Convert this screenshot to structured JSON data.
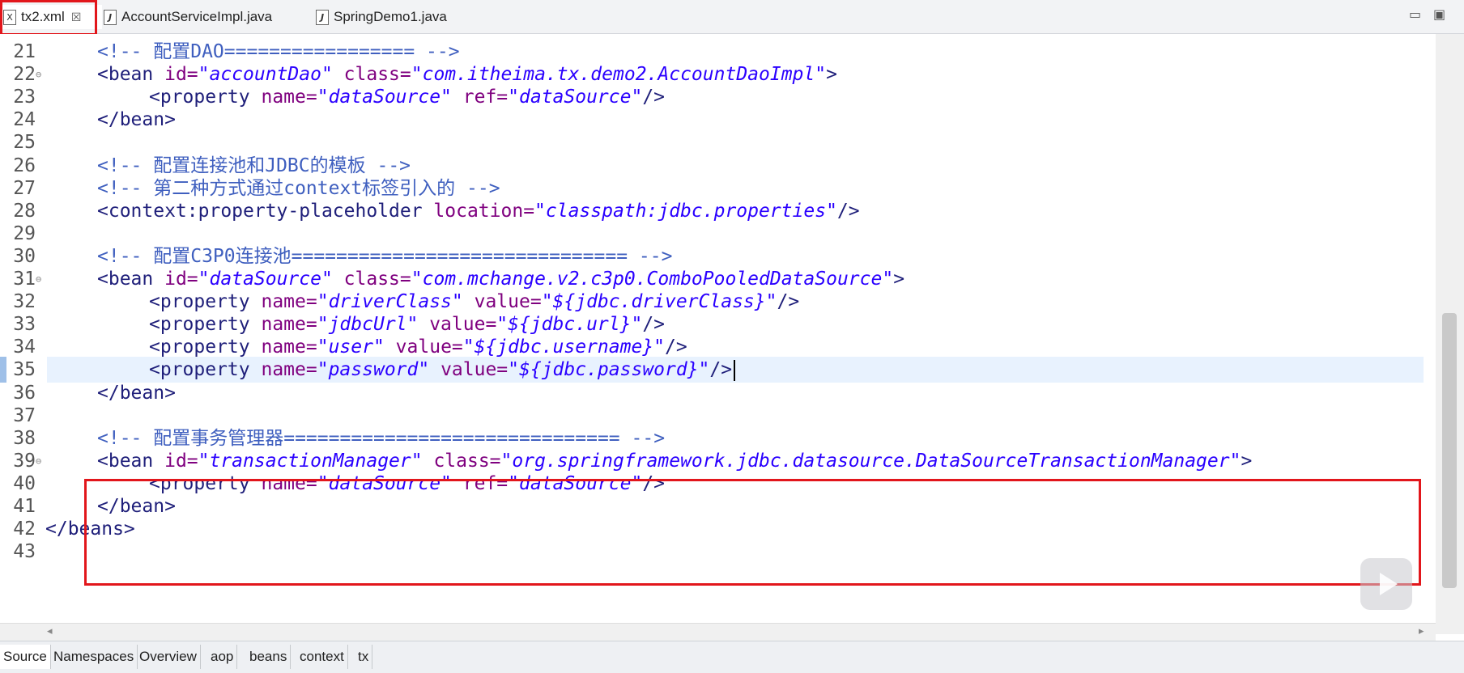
{
  "tabs": [
    {
      "label": "tx2.xml",
      "icon": "xml-file-icon",
      "active": true,
      "close": "☒"
    },
    {
      "label": "AccountServiceImpl.java",
      "icon": "java-file-icon",
      "active": false
    },
    {
      "label": "SpringDemo1.java",
      "icon": "java-file-icon",
      "active": false
    }
  ],
  "window_controls": {
    "minimize": "▭",
    "maximize": "▣"
  },
  "editor": {
    "current_line": 35,
    "lines": [
      {
        "n": "21",
        "indent": 1,
        "parts": [
          [
            "cmt",
            "<!-- 配置DAO================= -->"
          ]
        ]
      },
      {
        "n": "22",
        "indent": 1,
        "fold": true,
        "parts": [
          [
            "tag",
            "<bean "
          ],
          [
            "attr",
            "id="
          ],
          [
            "val",
            "\"accountDao\""
          ],
          [
            "attr",
            " class="
          ],
          [
            "val",
            "\"com.itheima.tx.demo2.AccountDaoImpl\""
          ],
          [
            "tag",
            ">"
          ]
        ]
      },
      {
        "n": "23",
        "indent": 2,
        "parts": [
          [
            "tag",
            "<property "
          ],
          [
            "attr",
            "name="
          ],
          [
            "val",
            "\"dataSource\""
          ],
          [
            "attr",
            " ref="
          ],
          [
            "val",
            "\"dataSource\""
          ],
          [
            "tag",
            "/>"
          ]
        ]
      },
      {
        "n": "24",
        "indent": 1,
        "parts": [
          [
            "tag",
            "</bean>"
          ]
        ]
      },
      {
        "n": "25",
        "indent": 1,
        "parts": []
      },
      {
        "n": "26",
        "indent": 1,
        "parts": [
          [
            "cmt",
            "<!-- 配置连接池和JDBC的模板 -->"
          ]
        ]
      },
      {
        "n": "27",
        "indent": 1,
        "parts": [
          [
            "cmt",
            "<!-- 第二种方式通过context标签引入的 -->"
          ]
        ]
      },
      {
        "n": "28",
        "indent": 1,
        "parts": [
          [
            "tag",
            "<context:property-placeholder "
          ],
          [
            "attr",
            "location="
          ],
          [
            "val",
            "\"classpath:jdbc.properties\""
          ],
          [
            "tag",
            "/>"
          ]
        ]
      },
      {
        "n": "29",
        "indent": 1,
        "parts": []
      },
      {
        "n": "30",
        "indent": 1,
        "parts": [
          [
            "cmt",
            "<!-- 配置C3P0连接池============================== -->"
          ]
        ]
      },
      {
        "n": "31",
        "indent": 1,
        "fold": true,
        "parts": [
          [
            "tag",
            "<bean "
          ],
          [
            "attr",
            "id="
          ],
          [
            "val",
            "\"dataSource\""
          ],
          [
            "attr",
            " class="
          ],
          [
            "val",
            "\"com.mchange.v2.c3p0.ComboPooledDataSource\""
          ],
          [
            "tag",
            ">"
          ]
        ]
      },
      {
        "n": "32",
        "indent": 2,
        "parts": [
          [
            "tag",
            "<property "
          ],
          [
            "attr",
            "name="
          ],
          [
            "val",
            "\"driverClass\""
          ],
          [
            "attr",
            " value="
          ],
          [
            "val",
            "\"${jdbc.driverClass}\""
          ],
          [
            "tag",
            "/>"
          ]
        ]
      },
      {
        "n": "33",
        "indent": 2,
        "parts": [
          [
            "tag",
            "<property "
          ],
          [
            "attr",
            "name="
          ],
          [
            "val",
            "\"jdbcUrl\""
          ],
          [
            "attr",
            " value="
          ],
          [
            "val",
            "\"${jdbc.url}\""
          ],
          [
            "tag",
            "/>"
          ]
        ]
      },
      {
        "n": "34",
        "indent": 2,
        "parts": [
          [
            "tag",
            "<property "
          ],
          [
            "attr",
            "name="
          ],
          [
            "val",
            "\"user\""
          ],
          [
            "attr",
            " value="
          ],
          [
            "val",
            "\"${jdbc.username}\""
          ],
          [
            "tag",
            "/>"
          ]
        ]
      },
      {
        "n": "35",
        "indent": 2,
        "parts": [
          [
            "tag",
            "<property "
          ],
          [
            "attr",
            "name="
          ],
          [
            "val",
            "\"password\""
          ],
          [
            "attr",
            " value="
          ],
          [
            "val",
            "\"${jdbc.password}\""
          ],
          [
            "tag",
            "/>"
          ]
        ]
      },
      {
        "n": "36",
        "indent": 1,
        "parts": [
          [
            "tag",
            "</bean>"
          ]
        ]
      },
      {
        "n": "37",
        "indent": 1,
        "parts": []
      },
      {
        "n": "38",
        "indent": 1,
        "parts": [
          [
            "cmt",
            "<!-- 配置事务管理器============================== -->"
          ]
        ]
      },
      {
        "n": "39",
        "indent": 1,
        "fold": true,
        "parts": [
          [
            "tag",
            "<bean "
          ],
          [
            "attr",
            "id="
          ],
          [
            "val",
            "\"transactionManager\""
          ],
          [
            "attr",
            " class="
          ],
          [
            "val",
            "\"org.springframework.jdbc.datasource.DataSourceTransactionManager\""
          ],
          [
            "tag",
            ">"
          ]
        ]
      },
      {
        "n": "40",
        "indent": 2,
        "parts": [
          [
            "tag",
            "<property "
          ],
          [
            "attr",
            "name="
          ],
          [
            "val",
            "\"dataSource\""
          ],
          [
            "attr",
            " ref="
          ],
          [
            "val",
            "\"dataSource\""
          ],
          [
            "tag",
            "/>"
          ]
        ]
      },
      {
        "n": "41",
        "indent": 1,
        "parts": [
          [
            "tag",
            "</bean>"
          ]
        ]
      },
      {
        "n": "42",
        "indent": 0,
        "parts": [
          [
            "tag",
            "</beans>"
          ]
        ]
      },
      {
        "n": "43",
        "indent": 0,
        "parts": []
      }
    ]
  },
  "bottom_tabs": [
    "Source",
    "Namespaces",
    "Overview",
    "aop",
    "beans",
    "context",
    "tx"
  ],
  "active_bottom_tab": "Source",
  "colors": {
    "highlight": "#e2161b",
    "comment": "#3f5fbf",
    "attr": "#7f007f",
    "value": "#2a00ff"
  }
}
